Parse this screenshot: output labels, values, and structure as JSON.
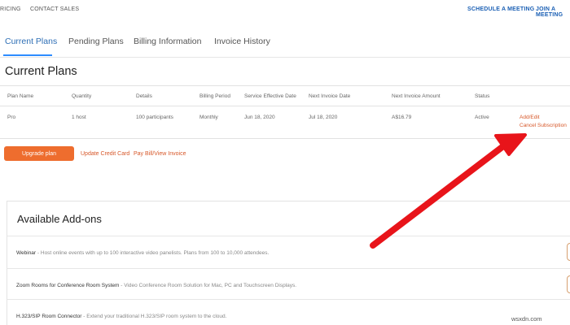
{
  "topnav": {
    "left_items": [
      "RICING",
      "CONTACT SALES"
    ],
    "right_items": [
      "SCHEDULE A MEETING",
      "JOIN A MEETING"
    ]
  },
  "tabs": [
    {
      "label": "Current Plans",
      "active": true
    },
    {
      "label": "Pending Plans",
      "active": false
    },
    {
      "label": "Billing Information",
      "active": false
    },
    {
      "label": "Invoice History",
      "active": false
    }
  ],
  "section_title": "Current Plans",
  "table": {
    "headers": [
      "Plan Name",
      "Quantity",
      "Details",
      "Billing Period",
      "Service Effective Date",
      "Next Invoice Date",
      "Next Invoice Amount",
      "Status"
    ],
    "row": [
      "Pro",
      "1 host",
      "100 participants",
      "Monthly",
      "Jun 18, 2020",
      "Jul 18, 2020",
      "A$16.79",
      "Active"
    ],
    "row_links": [
      "Add/Edit",
      "Cancel Subscription"
    ]
  },
  "actions": {
    "upgrade": "Upgrade plan",
    "update_card": "Update Credit Card",
    "pay_bill": "Pay Bill/View Invoice"
  },
  "addons": {
    "title": "Available Add-ons",
    "items": [
      {
        "name": "Webinar",
        "desc": " - Host online events with up to 100 interactive video panelists. Plans from 100 to 10,000 attendees."
      },
      {
        "name": "Zoom Rooms for Conference Room System",
        "desc": " - Video Conference Room Solution for Mac, PC and Touchscreen Displays."
      },
      {
        "name": "H.323/SIP Room Connector",
        "desc": " - Extend your traditional H.323/SIP room system to the cloud."
      }
    ]
  },
  "colors": {
    "accent_blue": "#2d8cff",
    "accent_orange": "#ee6d2e",
    "annotation_red": "#e8141a"
  },
  "watermark": "wsxdn.com"
}
